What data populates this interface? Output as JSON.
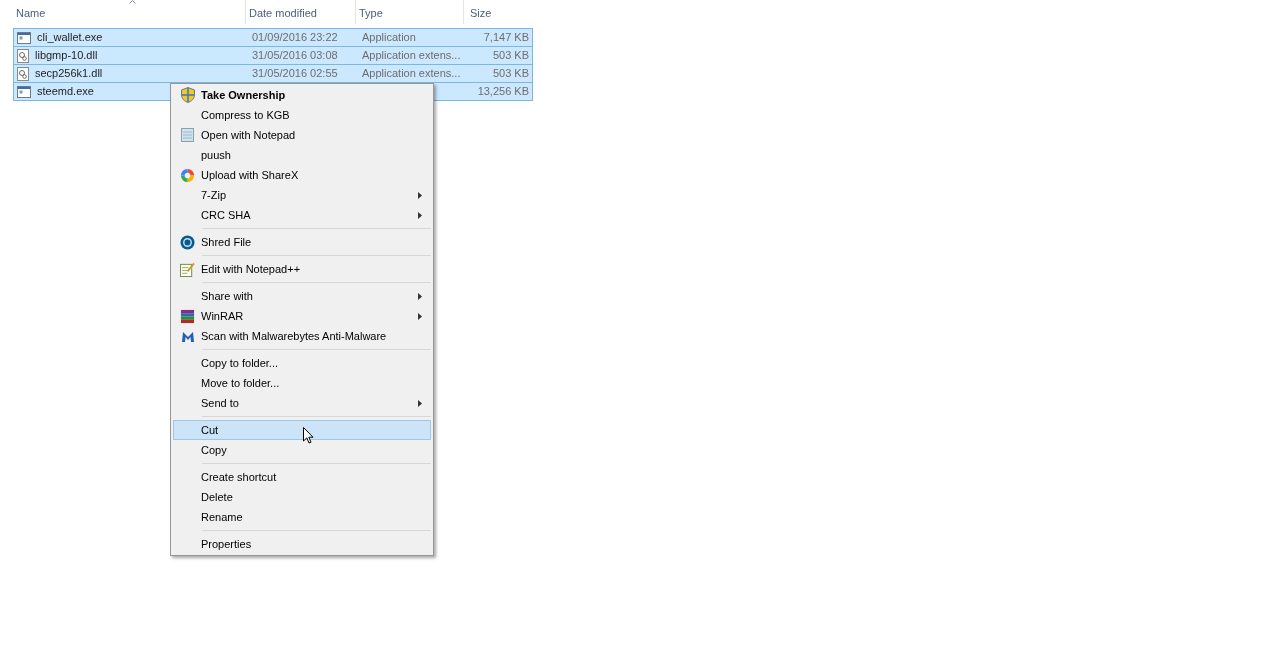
{
  "columns": [
    {
      "label": "Name",
      "sorted": true
    },
    {
      "label": "Date modified",
      "sorted": false
    },
    {
      "label": "Type",
      "sorted": false
    },
    {
      "label": "Size",
      "sorted": false
    }
  ],
  "files": [
    {
      "kind": "exe",
      "name": "cli_wallet.exe",
      "date": "01/09/2016 23:22",
      "type": "Application",
      "size": "7,147 KB",
      "selected": true
    },
    {
      "kind": "dll",
      "name": "libgmp-10.dll",
      "date": "31/05/2016 03:08",
      "type": "Application extens...",
      "size": "503 KB",
      "selected": true
    },
    {
      "kind": "dll",
      "name": "secp256k1.dll",
      "date": "31/05/2016 02:55",
      "type": "Application extens...",
      "size": "503 KB",
      "selected": true
    },
    {
      "kind": "exe",
      "name": "steemd.exe",
      "size": "13,256 KB",
      "selected": true
    }
  ],
  "context_menu": {
    "groups": [
      [
        {
          "label": "Take Ownership",
          "kind": "shield",
          "default": true,
          "submenu": false,
          "selected": false
        },
        {
          "label": "Compress to KGB",
          "submenu": false,
          "default": false,
          "selected": false
        },
        {
          "label": "Open with Notepad",
          "kind": "notepad",
          "submenu": false,
          "default": false,
          "selected": false
        },
        {
          "label": "puush",
          "submenu": false,
          "default": false,
          "selected": false
        },
        {
          "label": "Upload with ShareX",
          "kind": "ring",
          "submenu": false,
          "default": false,
          "selected": false
        },
        {
          "label": "7-Zip",
          "submenu": true,
          "default": false,
          "selected": false
        },
        {
          "label": "CRC SHA",
          "submenu": true,
          "default": false,
          "selected": false
        }
      ],
      [
        {
          "label": "Shred File",
          "kind": "disc",
          "submenu": false,
          "default": false,
          "selected": false
        }
      ],
      [
        {
          "label": "Edit with Notepad++",
          "kind": "edit",
          "submenu": false,
          "default": false,
          "selected": false
        }
      ],
      [
        {
          "label": "Share with",
          "submenu": true,
          "default": false,
          "selected": false
        },
        {
          "label": "WinRAR",
          "kind": "books",
          "submenu": true,
          "default": false,
          "selected": false
        },
        {
          "label": "Scan with Malwarebytes Anti-Malware",
          "kind": "m",
          "submenu": false,
          "default": false,
          "selected": false
        }
      ],
      [
        {
          "label": "Copy to folder...",
          "submenu": false,
          "default": false,
          "selected": false
        },
        {
          "label": "Move to folder...",
          "submenu": false,
          "default": false,
          "selected": false
        },
        {
          "label": "Send to",
          "submenu": true,
          "default": false,
          "selected": false
        }
      ],
      [
        {
          "label": "Cut",
          "submenu": false,
          "default": false,
          "selected": true
        },
        {
          "label": "Copy",
          "submenu": false,
          "default": false,
          "selected": false
        }
      ],
      [
        {
          "label": "Create shortcut",
          "submenu": false,
          "default": false,
          "selected": false
        },
        {
          "label": "Delete",
          "submenu": false,
          "default": false,
          "selected": false
        },
        {
          "label": "Rename",
          "submenu": false,
          "default": false,
          "selected": false
        }
      ],
      [
        {
          "label": "Properties",
          "submenu": false,
          "default": false,
          "selected": false
        }
      ]
    ]
  }
}
